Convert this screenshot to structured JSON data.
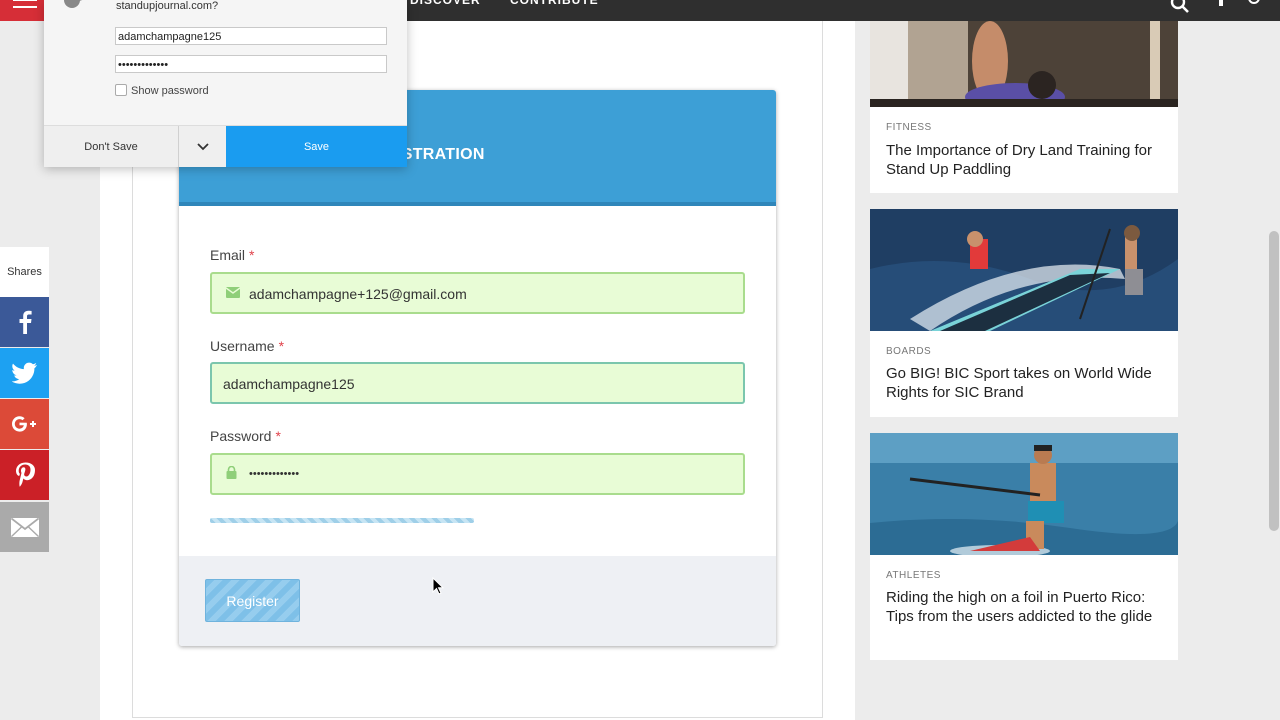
{
  "nav": {
    "links": [
      "DISCOVER",
      "CONTRIBUTE"
    ]
  },
  "save_password_popup": {
    "question": "standupjournal.com?",
    "username_value": "adamchampagne125",
    "password_value": "•••••••••••••",
    "show_password_label": "Show password",
    "dont_save_label": "Don't Save",
    "save_label": "Save"
  },
  "registration": {
    "header_title": "ISTRATION",
    "fields": [
      {
        "label": "Email",
        "required_mark": "*",
        "value": "adamchampagne+125@gmail.com",
        "icon": "envelope-icon"
      },
      {
        "label": "Username",
        "required_mark": "*",
        "value": "adamchampagne125"
      },
      {
        "label": "Password",
        "required_mark": "*",
        "value": "•••••••••••••",
        "icon": "lock-icon"
      }
    ],
    "register_label": "Register"
  },
  "share": {
    "label": "Shares",
    "buttons": [
      {
        "network": "facebook",
        "color": "#3b5998"
      },
      {
        "network": "twitter",
        "color": "#1da1f2"
      },
      {
        "network": "google-plus",
        "color": "#dc4a38"
      },
      {
        "network": "pinterest",
        "color": "#cb2027"
      },
      {
        "network": "email",
        "color": "#aaaaaa"
      }
    ]
  },
  "articles": [
    {
      "category": "FITNESS",
      "title": "The Importance of Dry Land Training for Stand Up Paddling"
    },
    {
      "category": "BOARDS",
      "title": "Go BIG! BIC Sport takes on World Wide Rights for SIC Brand"
    },
    {
      "category": "ATHLETES",
      "title": "Riding the high on a foil in Puerto Rico: Tips from the users addicted to the glide"
    }
  ],
  "colors": {
    "accent_red": "#d62e37",
    "header_blue": "#3d9fd6",
    "save_blue": "#1a9cf0",
    "field_green_bg": "#e8fcd6"
  }
}
